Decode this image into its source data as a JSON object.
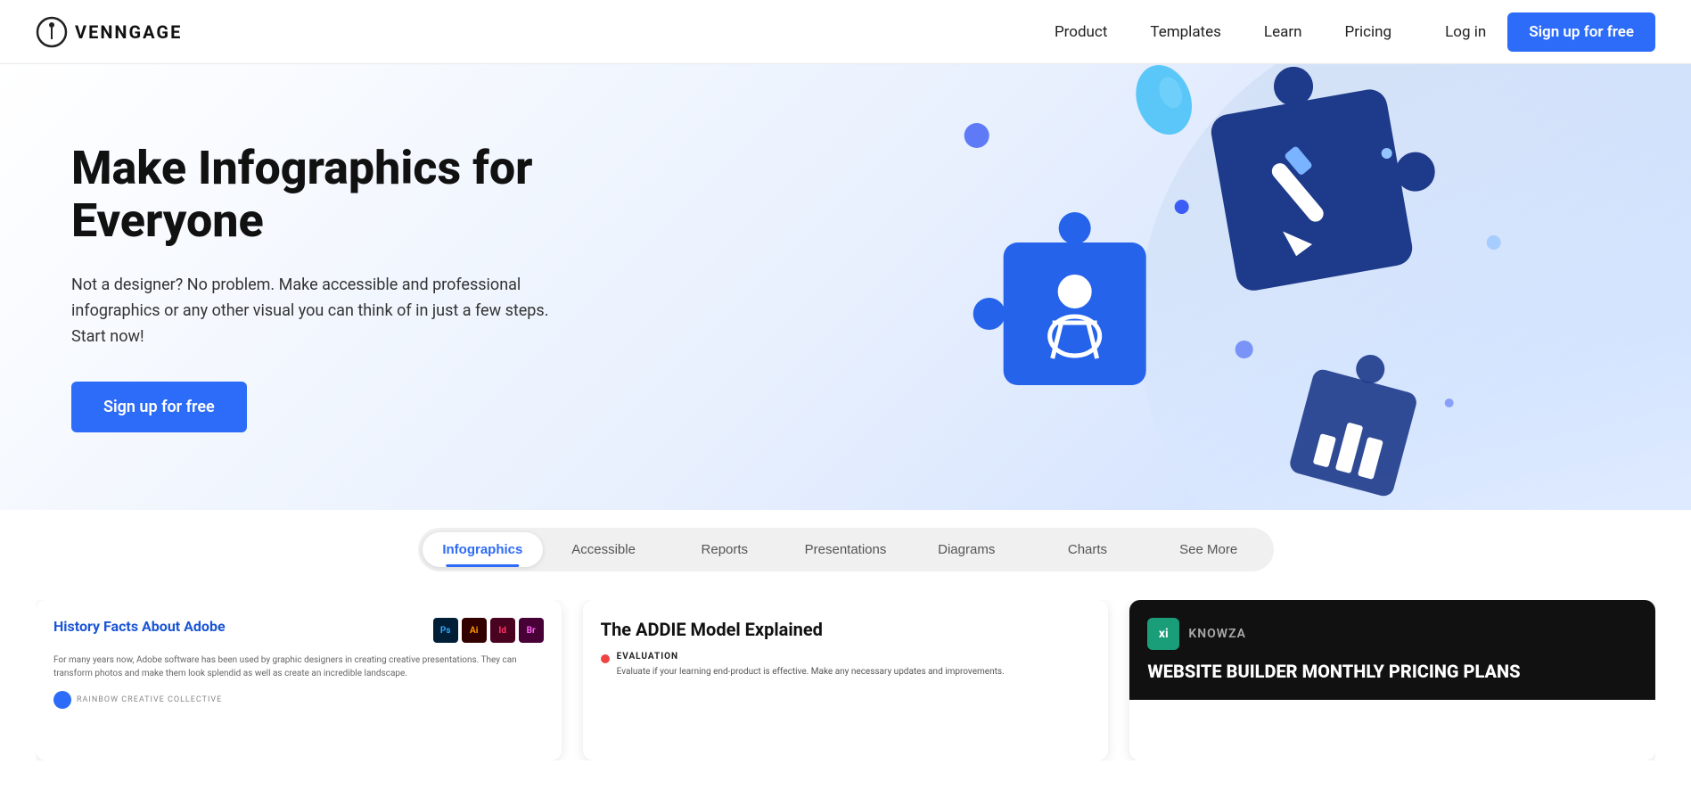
{
  "brand": {
    "name": "VENNGAGE",
    "logo_alt": "Venngage logo"
  },
  "nav": {
    "links": [
      {
        "label": "Product",
        "id": "product"
      },
      {
        "label": "Templates",
        "id": "templates"
      },
      {
        "label": "Learn",
        "id": "learn"
      },
      {
        "label": "Pricing",
        "id": "pricing"
      }
    ],
    "login_label": "Log in",
    "signup_label": "Sign up for free"
  },
  "hero": {
    "title": "Make Infographics for Everyone",
    "subtitle": "Not a designer? No problem. Make accessible and professional infographics or any other visual you can think of in just a few steps. Start now!",
    "cta_label": "Sign up for free"
  },
  "tabs": {
    "items": [
      {
        "label": "Infographics",
        "active": true
      },
      {
        "label": "Accessible",
        "active": false
      },
      {
        "label": "Reports",
        "active": false
      },
      {
        "label": "Presentations",
        "active": false
      },
      {
        "label": "Diagrams",
        "active": false
      },
      {
        "label": "Charts",
        "active": false
      },
      {
        "label": "See More",
        "active": false
      }
    ]
  },
  "cards": [
    {
      "id": "adobe",
      "title": "History Facts About Adobe",
      "icons": [
        "Ps",
        "Ai",
        "Id",
        "Br"
      ],
      "body_text": "For many years now, Adobe software has been used by graphic designers in creating creative presentations. They can transform photos and make them look splendid as well as create an incredible landscape.",
      "footer_text": "RAINBOW CREATIVE COLLECTIVE"
    },
    {
      "id": "addie",
      "title": "The ADDIE Model Explained",
      "eval_label": "EVALUATION",
      "eval_text": "Evaluate if your learning end-product is effective. Make any necessary updates and improvements."
    },
    {
      "id": "knowza",
      "brand_label": "knowza",
      "brand_icon": "xi",
      "title": "WEBSITE BUILDER\nMONTHLY PRICING PLANS"
    }
  ]
}
